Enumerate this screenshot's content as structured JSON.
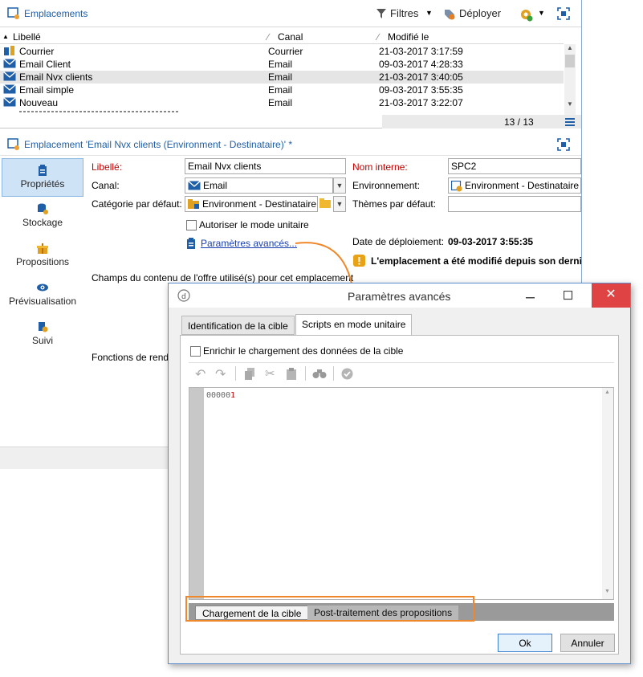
{
  "main": {
    "title": "Emplacements",
    "toolbar": {
      "filters": "Filtres",
      "deploy": "Déployer"
    },
    "list": {
      "columns": [
        "Libellé",
        "Canal",
        "Modifié le"
      ],
      "rows": [
        {
          "label": "Courrier",
          "channel": "Courrier",
          "modified": "21-03-2017 3:17:59"
        },
        {
          "label": "Email Client",
          "channel": "Email",
          "modified": "09-03-2017 4:28:33"
        },
        {
          "label": "Email Nvx clients",
          "channel": "Email",
          "modified": "21-03-2017 3:40:05"
        },
        {
          "label": "Email simple",
          "channel": "Email",
          "modified": "09-03-2017 3:55:35"
        },
        {
          "label": "Nouveau",
          "channel": "Email",
          "modified": "21-03-2017 3:22:07"
        }
      ],
      "count": "13 / 13"
    },
    "detail": {
      "header": "Emplacement 'Email Nvx clients (Environment - Destinataire)' *",
      "nav": [
        "Propriétés",
        "Stockage",
        "Propositions",
        "Prévisualisation",
        "Suivi"
      ],
      "label_label": "Libellé:",
      "label_value": "Email Nvx clients",
      "channel_label": "Canal:",
      "channel_value": "Email",
      "category_label": "Catégorie par défaut:",
      "category_value": "Environment - Destinataire",
      "internal_name_label": "Nom interne:",
      "internal_name_value": "SPC2",
      "environment_label": "Environnement:",
      "environment_value": "Environment - Destinataire",
      "themes_label": "Thèmes par défaut:",
      "unitary_mode": "Autoriser le mode unitaire",
      "advanced_link": "Paramètres avancés...",
      "deploy_date_label": "Date de déploiement:",
      "deploy_date_value": "09-03-2017 3:55:35",
      "warning": "L'emplacement a été modifié depuis son derni",
      "fields_section": "Champs du contenu de l'offre utilisé(s) pour cet emplacement",
      "functions_section": "Fonctions de rend"
    }
  },
  "dialog": {
    "title": "Paramètres avancés",
    "tabs": [
      "Identification de la cible",
      "Scripts en mode unitaire"
    ],
    "enrich_checkbox": "Enrichir le chargement des données de la cible",
    "editor_line_prefix": "00000",
    "editor_line_num": "1",
    "subtabs": [
      "Chargement de la cible",
      "Post-traitement des propositions"
    ],
    "ok": "Ok",
    "cancel": "Annuler"
  },
  "colors": {
    "accent": "#1f5fa8",
    "required": "#c00000",
    "highlight": "#f0882b",
    "close": "#e04343"
  }
}
